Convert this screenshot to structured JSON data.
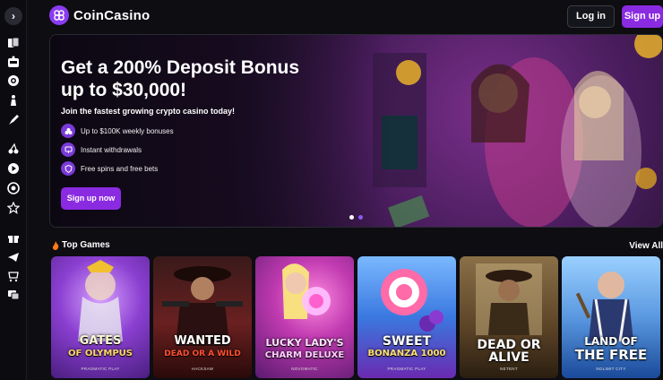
{
  "brand": {
    "name": "CoinCasino",
    "accent": "#8a2be2"
  },
  "header": {
    "login_label": "Log in",
    "signup_label": "Sign up"
  },
  "sidebar": {
    "toggle": "›",
    "icons": [
      "cards-icon",
      "slot-machine-icon",
      "poker-chip-icon",
      "chess-icon",
      "rocket-icon",
      "cherries-icon",
      "play-icon",
      "chip-icon",
      "star-icon",
      "gift-icon",
      "telegram-icon",
      "shop-icon",
      "chat-icon"
    ]
  },
  "banner": {
    "title_line1": "Get a 200% Deposit Bonus",
    "title_line2": "up to $30,000!",
    "subtitle": "Join the fastest growing crypto casino today!",
    "features": [
      "Up to $100K weekly bonuses",
      "Instant withdrawals",
      "Free spins and free bets"
    ],
    "cta_label": "Sign up now",
    "slides": 2,
    "active_slide": 1
  },
  "top_games": {
    "title": "Top Games",
    "view_all": "View All",
    "games": [
      {
        "name_line1": "GATES",
        "name_line2": "OF OLYMPUS",
        "provider": "PRAGMATIC PLAY",
        "color": "#8a3fd0"
      },
      {
        "name_line1": "WANTED",
        "name_line2": "DEAD OR A WILD",
        "provider": "HACKSAW",
        "color": "#5a1a1a"
      },
      {
        "name_line1": "LUCKY LADY'S",
        "name_line2": "CHARM DELUXE",
        "provider": "NOVOMATIC",
        "color": "#a62ca8"
      },
      {
        "name_line1": "SWEET",
        "name_line2": "BONANZA 1000",
        "provider": "PRAGMATIC PLAY",
        "color": "#4a7be0"
      },
      {
        "name_line1": "DEAD OR ALIVE",
        "name_line2": "",
        "provider": "NETENT",
        "color": "#6a5030"
      },
      {
        "name_line1": "LAND OF",
        "name_line2": "THE FREE",
        "provider": "NOLIMIT CITY",
        "color": "#3e7bc8"
      }
    ]
  }
}
